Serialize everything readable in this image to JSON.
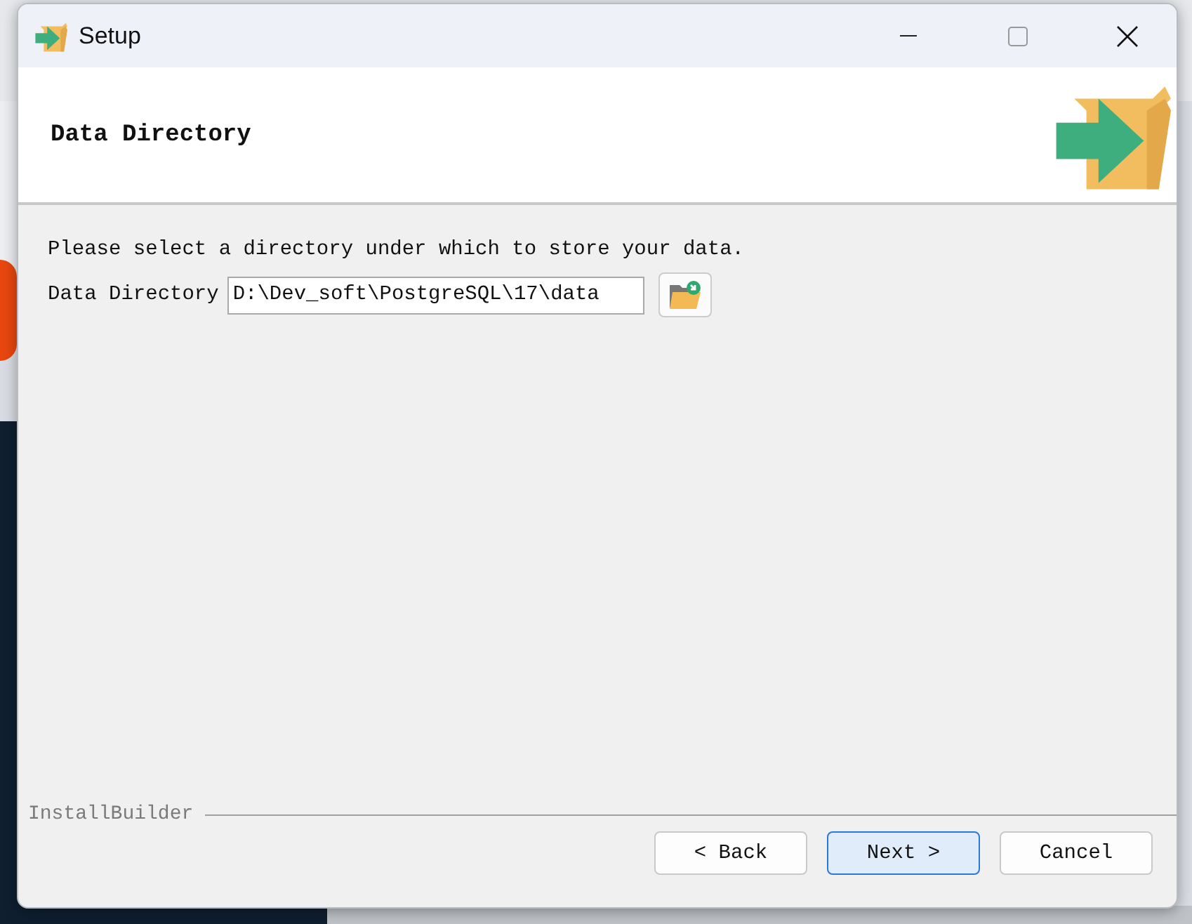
{
  "window": {
    "title": "Setup"
  },
  "header": {
    "title": "Data Directory"
  },
  "body": {
    "prompt": "Please select a directory under which to store your data.",
    "field": {
      "label": "Data Directory",
      "value": "D:\\Dev_soft\\PostgreSQL\\17\\data"
    }
  },
  "footer": {
    "brand": "InstallBuilder",
    "buttons": [
      {
        "label": "< Back",
        "default": false
      },
      {
        "label": "Next >",
        "default": true
      },
      {
        "label": "Cancel",
        "default": false
      }
    ]
  }
}
